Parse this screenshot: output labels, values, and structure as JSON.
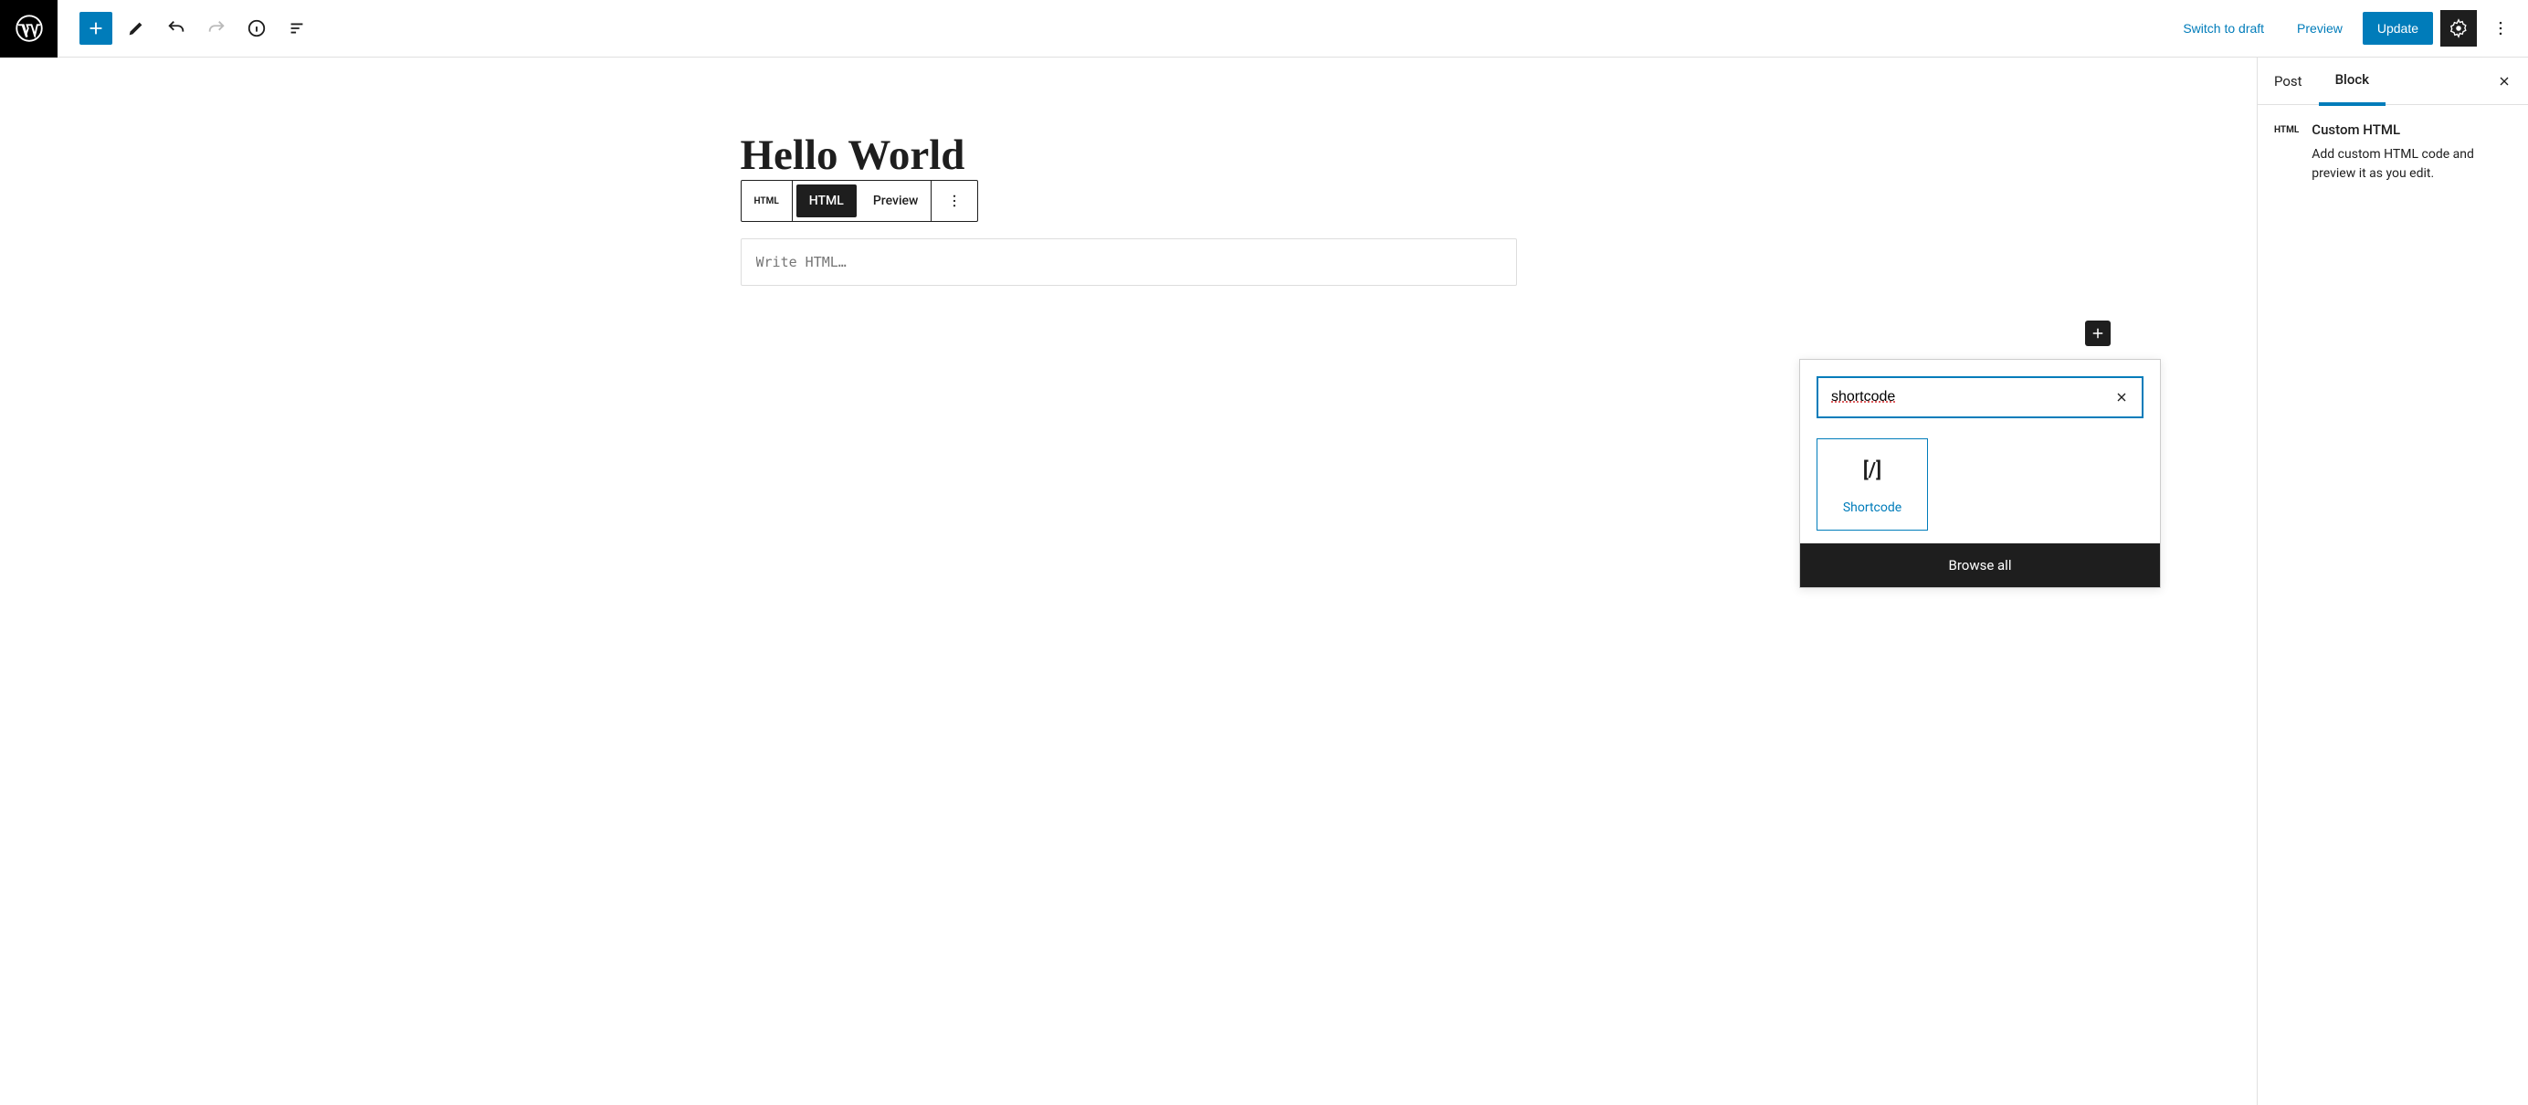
{
  "header": {
    "switch_to_draft": "Switch to draft",
    "preview": "Preview",
    "update": "Update"
  },
  "editor": {
    "title": "Hello World",
    "block_toolbar": {
      "type_label": "HTML",
      "tab_html": "HTML",
      "tab_preview": "Preview"
    },
    "html_placeholder": "Write HTML…"
  },
  "inserter": {
    "search_value": "shortcode",
    "result_label": "Shortcode",
    "browse_all": "Browse all"
  },
  "sidebar": {
    "tab_post": "Post",
    "tab_block": "Block",
    "block_icon": "HTML",
    "block_title": "Custom HTML",
    "block_desc": "Add custom HTML code and preview it as you edit."
  }
}
